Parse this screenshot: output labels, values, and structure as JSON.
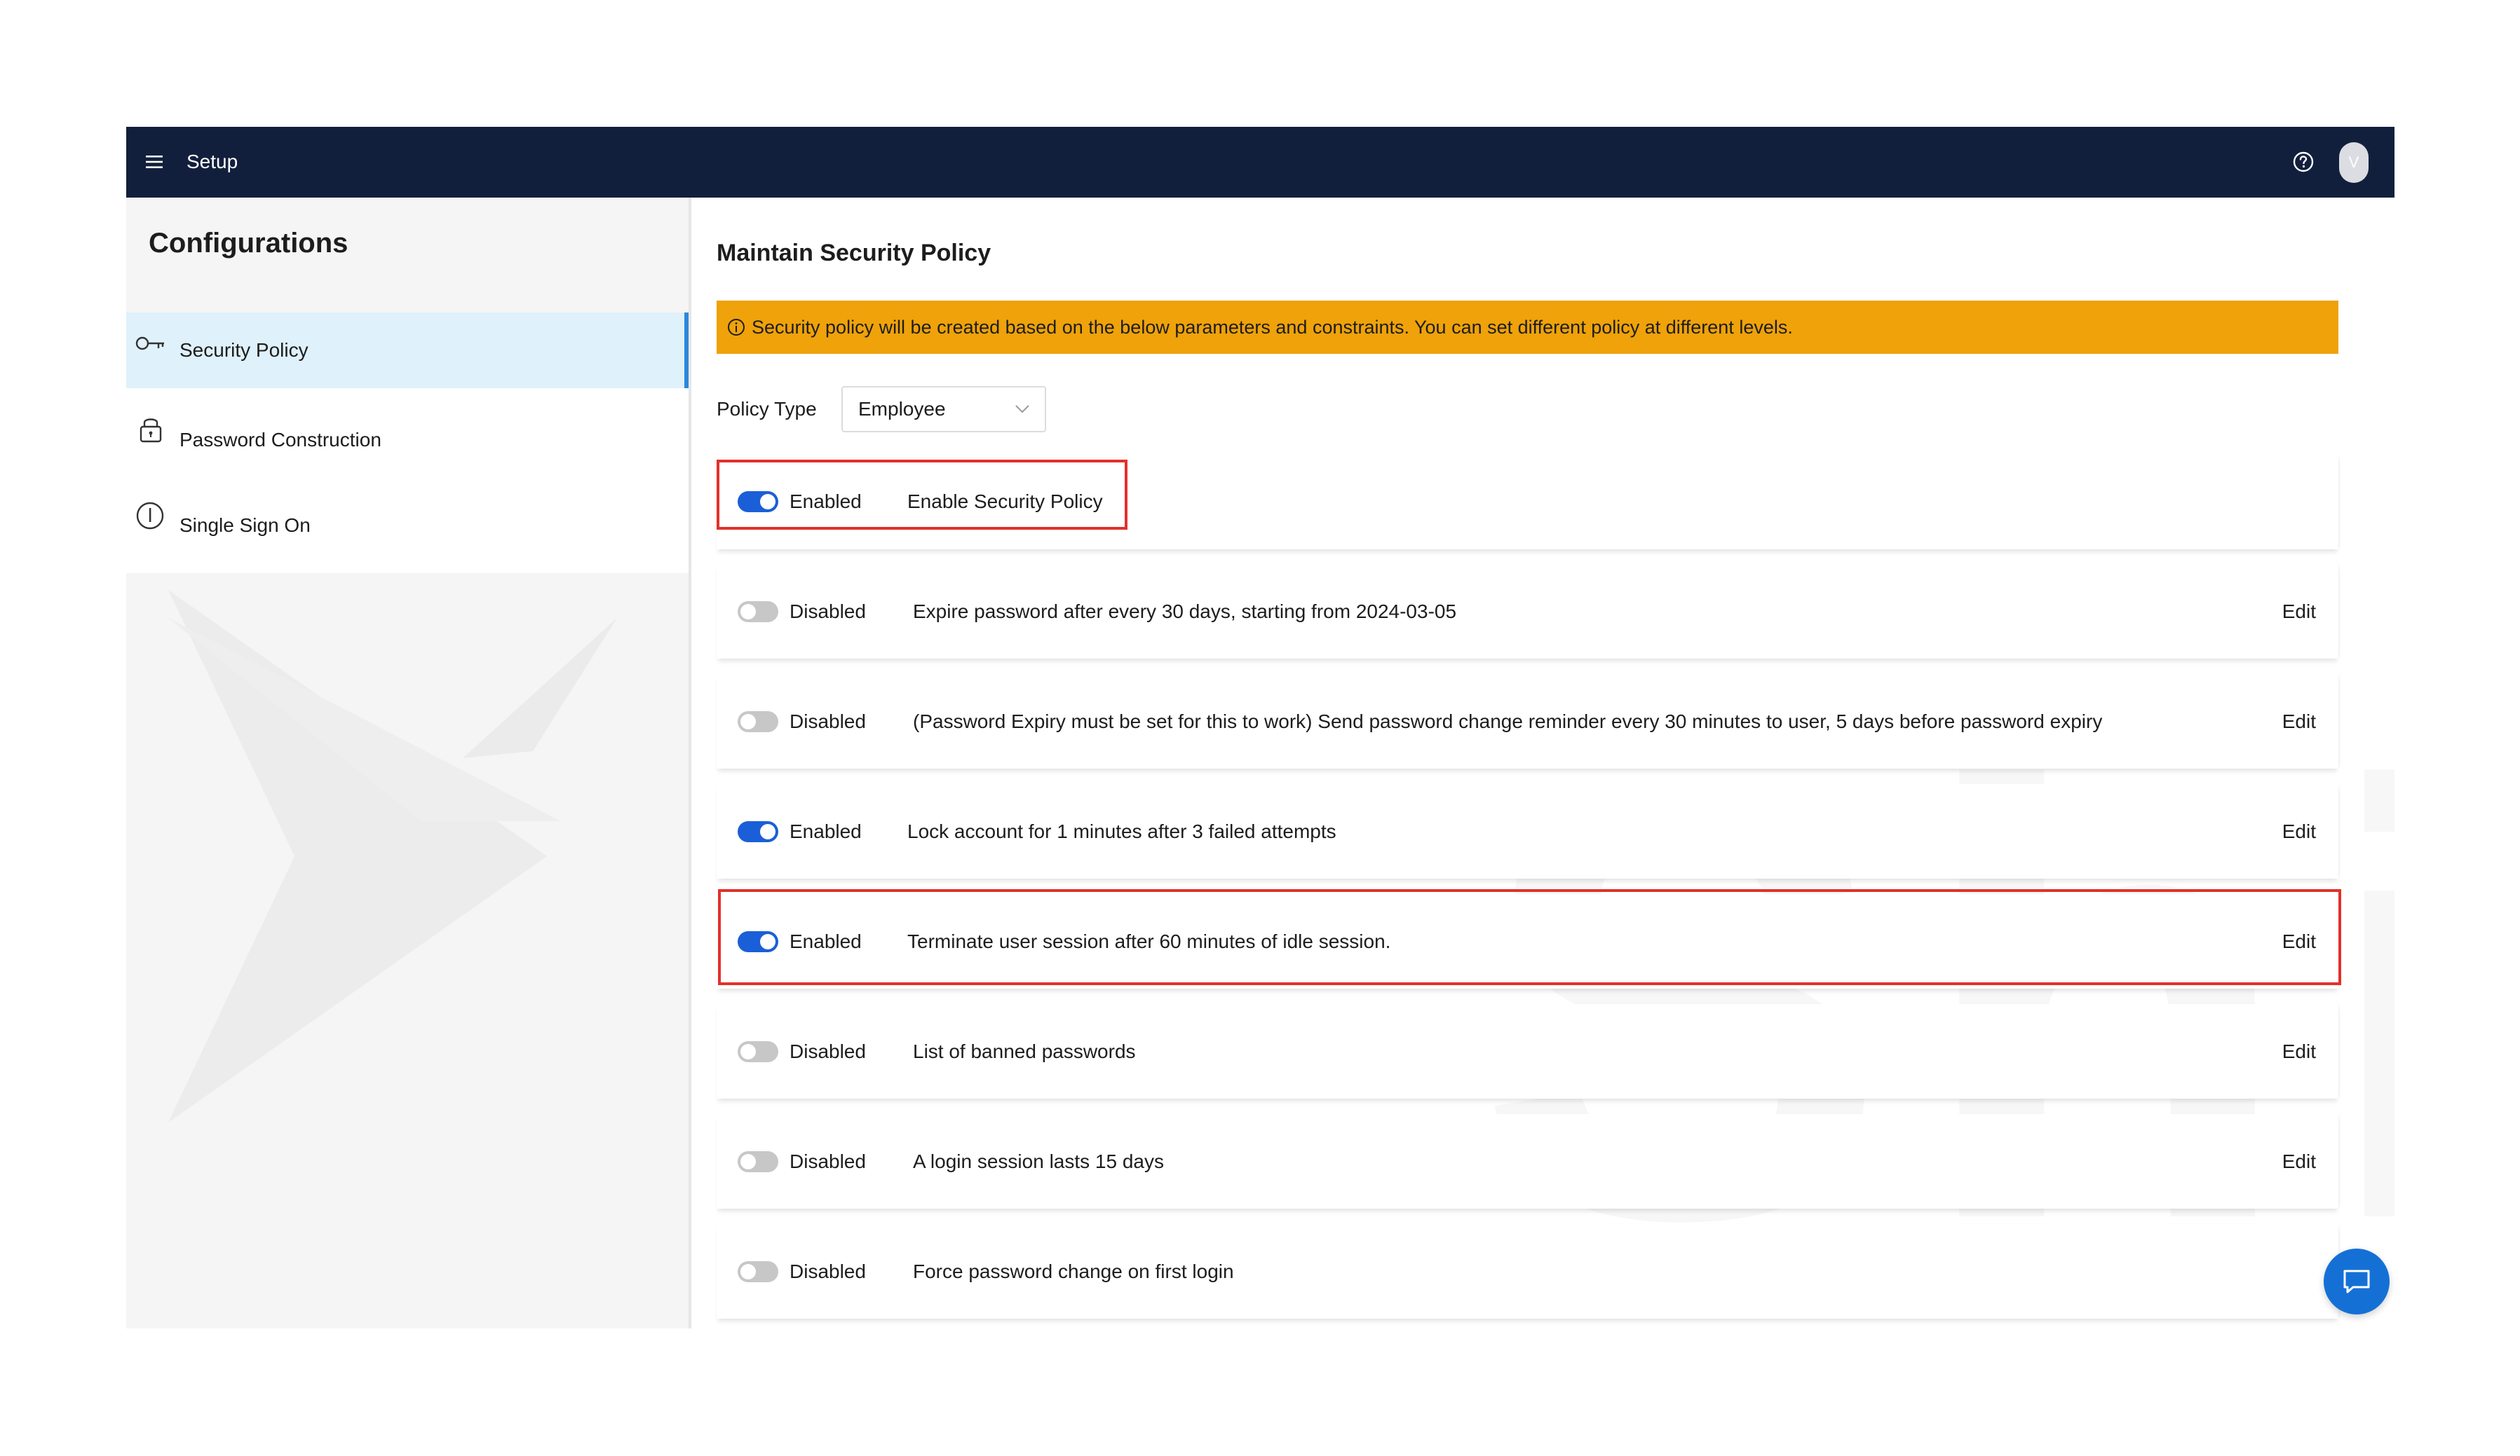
{
  "topbar": {
    "title": "Setup",
    "menu_icon": "hamburger-menu-icon",
    "help_icon": "question-circle-icon",
    "avatar_initial": "V"
  },
  "sidebar": {
    "title": "Configurations",
    "items": [
      {
        "label": "Security Policy",
        "icon": "key-icon",
        "active": true
      },
      {
        "label": "Password Construction",
        "icon": "lock-icon",
        "active": false
      },
      {
        "label": "Single Sign On",
        "icon": "info-circle-icon",
        "active": false
      }
    ]
  },
  "main": {
    "title": "Maintain Security Policy",
    "banner": {
      "icon": "info-circle-icon",
      "text": "Security policy will be created based on the below parameters and constraints. You can set different policy at different levels."
    },
    "policy_type": {
      "label": "Policy Type",
      "value": "Employee"
    },
    "edit_label": "Edit",
    "rows": [
      {
        "enabled": true,
        "status": "Enabled",
        "description": "Enable Security Policy",
        "has_edit": false,
        "highlighted": true
      },
      {
        "enabled": false,
        "status": "Disabled",
        "description": "Expire password after every 30 days, starting from 2024-03-05",
        "has_edit": true,
        "highlighted": false
      },
      {
        "enabled": false,
        "status": "Disabled",
        "description": "(Password Expiry must be set for this to work) Send password change reminder every 30 minutes to user, 5 days before password expiry",
        "has_edit": true,
        "highlighted": false
      },
      {
        "enabled": true,
        "status": "Enabled",
        "description": "Lock account for 1 minutes after 3 failed attempts",
        "has_edit": true,
        "highlighted": false
      },
      {
        "enabled": true,
        "status": "Enabled",
        "description": "Terminate user session after 60 minutes of idle session.",
        "has_edit": true,
        "highlighted": true
      },
      {
        "enabled": false,
        "status": "Disabled",
        "description": "List of banned passwords",
        "has_edit": true,
        "highlighted": false
      },
      {
        "enabled": false,
        "status": "Disabled",
        "description": "A login session lasts 15 days",
        "has_edit": true,
        "highlighted": false
      },
      {
        "enabled": false,
        "status": "Disabled",
        "description": "Force password change on first login",
        "has_edit": false,
        "highlighted": false
      }
    ]
  },
  "watermark_text": "Shipsy",
  "chat_button_icon": "chat-bubble-icon",
  "colors": {
    "topbar": "#121f3c",
    "banner": "#efa20a",
    "toggle_on": "#1a5fd7",
    "toggle_off": "#c7c7c7",
    "highlight": "#e2312a",
    "sidebar_active": "#dff1fa",
    "sidebar_active_border": "#2c87dd",
    "chat_button": "#1570d6"
  }
}
